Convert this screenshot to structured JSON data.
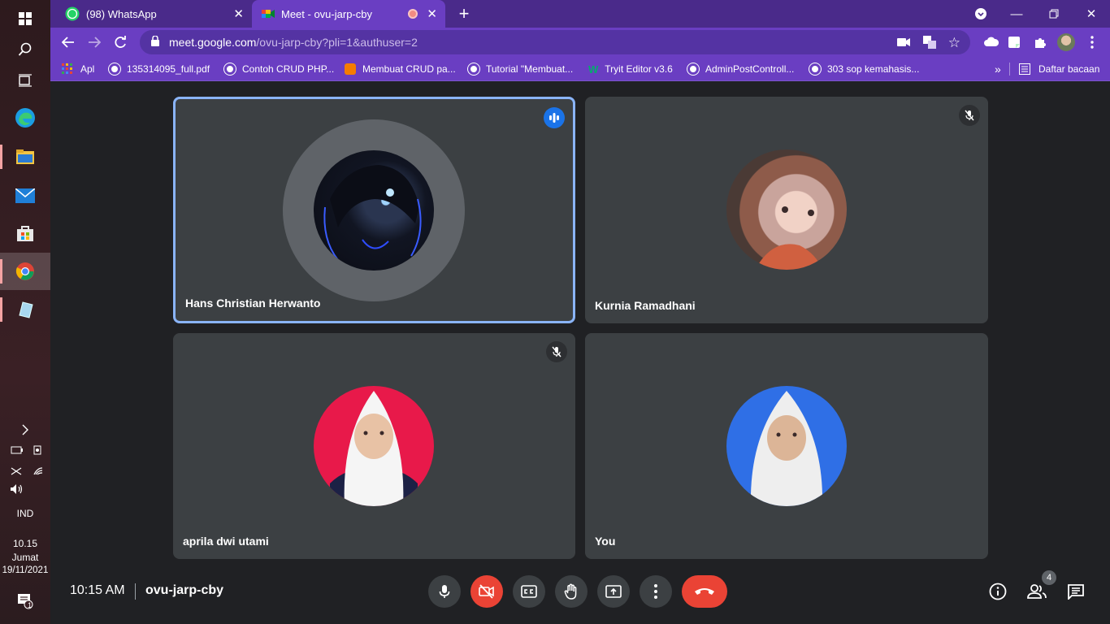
{
  "browser": {
    "tabs": [
      {
        "title": "(98) WhatsApp",
        "badge": "98"
      },
      {
        "title": "Meet - ovu-jarp-cby"
      }
    ],
    "new_tab": "+",
    "url_host": "meet.google.com",
    "url_path": "/ovu-jarp-cby?pli=1&authuser=2",
    "bookmarks": [
      "Apl",
      "135314095_full.pdf",
      "Contoh CRUD PHP...",
      "Membuat CRUD pa...",
      "Tutorial \"Membuat...",
      "Tryit Editor v3.6",
      "AdminPostControll...",
      "303 sop kemahasis..."
    ],
    "more_bookmarks": "»",
    "reading_list": "Daftar bacaan"
  },
  "taskbar": {
    "language": "IND",
    "time": "10.15",
    "day": "Jumat",
    "date": "19/11/2021",
    "notifications": "1"
  },
  "meet": {
    "participants": [
      {
        "name": "Hans Christian Herwanto",
        "status": "speaking"
      },
      {
        "name": "Kurnia Ramadhani",
        "status": "muted"
      },
      {
        "name": "aprila dwi utami",
        "status": "muted"
      },
      {
        "name": "You",
        "status": ""
      }
    ],
    "time": "10:15 AM",
    "code": "ovu-jarp-cby",
    "people_count": "4"
  }
}
